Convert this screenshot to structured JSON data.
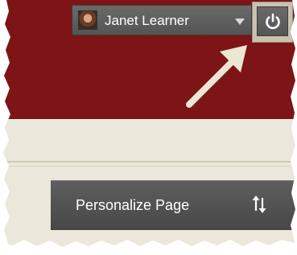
{
  "header": {
    "user_name": "Janet Learner",
    "avatar": "user-avatar-photo",
    "dropdown_icon": "caret-down-icon",
    "logout_icon": "power-icon"
  },
  "annotation": {
    "arrow_icon": "pointer-arrow-icon"
  },
  "panel": {
    "personalize_label": "Personalize Page",
    "sort_icon": "reorder-arrows-icon"
  },
  "colors": {
    "header_bg": "#7d1416",
    "body_bg": "#ebe7da",
    "control_bg": "#5a5a5a",
    "arrow": "#ece6d4"
  }
}
